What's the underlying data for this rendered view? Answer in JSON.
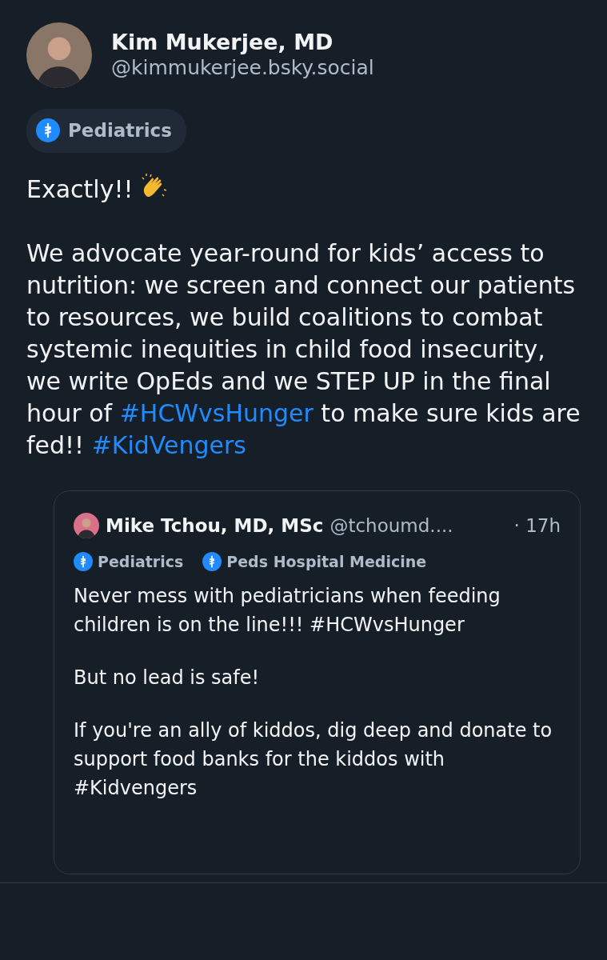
{
  "author": {
    "name": "Kim Mukerjee, MD",
    "handle": "@kimmukerjee.bsky.social"
  },
  "labels": [
    {
      "text": "Pediatrics"
    }
  ],
  "post": {
    "paragraphs": [
      [
        {
          "kind": "plain",
          "text": "Exactly!!"
        },
        {
          "kind": "clap"
        }
      ],
      [
        {
          "kind": "plain",
          "text": "We advocate year-round for kids’ access to nutrition: we screen and connect our patients to resources, we build coalitions to combat systemic inequities in child food insecurity, we write OpEds and we STEP UP in the final hour of "
        },
        {
          "kind": "hashtag",
          "text": "#HCWvsHunger"
        },
        {
          "kind": "plain",
          "text": " to make sure kids are fed!! "
        },
        {
          "kind": "hashtag",
          "text": "#KidVengers"
        }
      ]
    ]
  },
  "quote": {
    "name": "Mike Tchou, MD, MSc",
    "handle": "@tchoumd....",
    "time": "· 17h",
    "labels": [
      {
        "text": "Pediatrics"
      },
      {
        "text": "Peds Hospital Medicine"
      }
    ],
    "paragraphs": [
      "Never mess with pediatricians when feeding children is on the line!!! #HCWvsHunger",
      "But no lead is safe!",
      "If you're an ally of kiddos, dig deep and donate to support food banks for the kiddos with #Kidvengers"
    ]
  }
}
